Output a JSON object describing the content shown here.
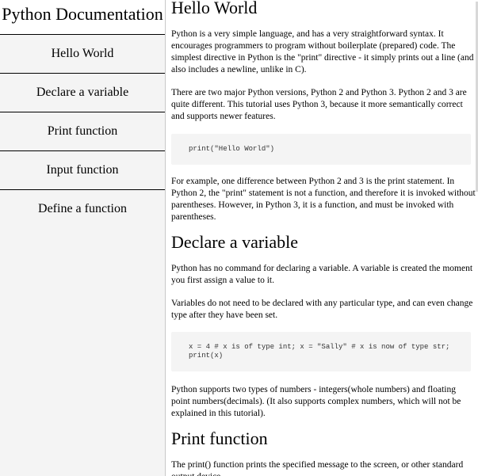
{
  "nav": {
    "title": "Python Documentation",
    "items": [
      {
        "label": "Hello World"
      },
      {
        "label": "Declare a variable"
      },
      {
        "label": "Print function"
      },
      {
        "label": "Input function"
      },
      {
        "label": "Define a function"
      }
    ]
  },
  "sections": {
    "hello_world": {
      "title": "Hello World",
      "p1": "Python is a very simple language, and has a very straightforward syntax. It encourages programmers to program without boilerplate (prepared) code. The simplest directive in Python is the \"print\" directive - it simply prints out a line (and also includes a newline, unlike in C).",
      "p2": "There are two major Python versions, Python 2 and Python 3. Python 2 and 3 are quite different. This tutorial uses Python 3, because it more semantically correct and supports newer features.",
      "code": "print(\"Hello World\")",
      "p3": "For example, one difference between Python 2 and 3 is the print statement. In Python 2, the \"print\" statement is not a function, and therefore it is invoked without parentheses. However, in Python 3, it is a function, and must be invoked with parentheses."
    },
    "declare_variable": {
      "title": "Declare a variable",
      "p1": "Python has no command for declaring a variable. A variable is created the moment you first assign a value to it.",
      "p2": "Variables do not need to be declared with any particular type, and can even change type after they have been set.",
      "code": "x = 4 # x is of type int; x = \"Sally\" # x is now of type str;\nprint(x)",
      "p3": "Python supports two types of numbers - integers(whole numbers) and floating point numbers(decimals). (It also supports complex numbers, which will not be explained in this tutorial)."
    },
    "print_function": {
      "title": "Print function",
      "p1": "The print() function prints the specified message to the screen, or other standard output device."
    }
  }
}
